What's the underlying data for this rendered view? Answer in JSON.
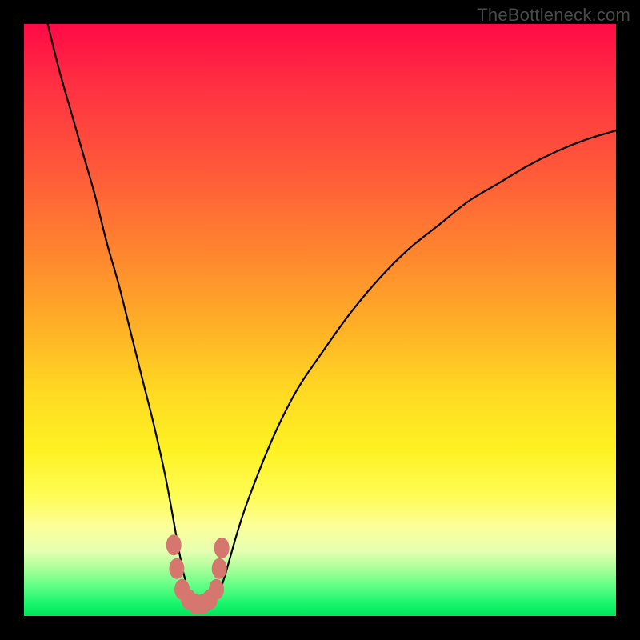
{
  "watermark": "TheBottleneck.com",
  "chart_data": {
    "type": "line",
    "title": "",
    "xlabel": "",
    "ylabel": "",
    "xlim": [
      0,
      100
    ],
    "ylim": [
      0,
      100
    ],
    "series": [
      {
        "name": "bottleneck-curve",
        "x": [
          4,
          6,
          8,
          10,
          12,
          14,
          16,
          18,
          20,
          22,
          24,
          26,
          27,
          28,
          29,
          30,
          31,
          32,
          33,
          34,
          36,
          38,
          42,
          46,
          50,
          55,
          60,
          65,
          70,
          75,
          80,
          85,
          90,
          95,
          100
        ],
        "values": [
          100,
          92,
          85,
          78,
          71,
          63,
          56,
          48,
          40,
          32,
          23,
          12,
          7,
          4,
          2,
          1,
          1,
          2,
          4,
          7,
          14,
          20,
          30,
          38,
          44,
          51,
          57,
          62,
          66,
          70,
          73,
          76,
          78.5,
          80.5,
          82
        ]
      }
    ],
    "highlight_markers": {
      "color": "#d5766f",
      "points_x": [
        25.3,
        25.8,
        26.7,
        27.8,
        29.0,
        30.2,
        31.4,
        32.5,
        33.0,
        33.4
      ],
      "points_y": [
        12.0,
        8.0,
        4.5,
        2.8,
        2.0,
        2.0,
        2.8,
        4.5,
        8.0,
        11.5
      ]
    }
  }
}
